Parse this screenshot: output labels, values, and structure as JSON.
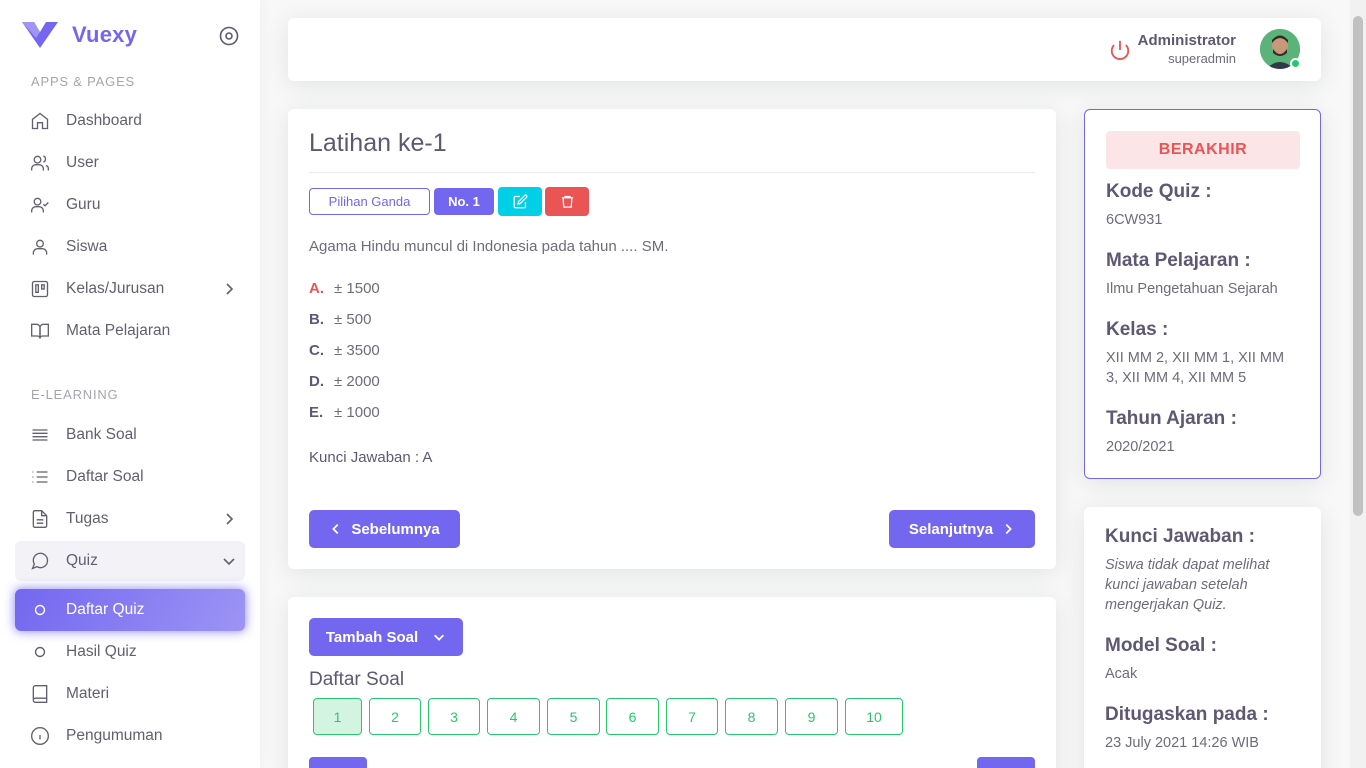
{
  "brand": {
    "name": "Vuexy"
  },
  "sidebar": {
    "section_apps": "APPS & PAGES",
    "section_elearning": "E-LEARNING",
    "items": [
      {
        "label": "Dashboard"
      },
      {
        "label": "User"
      },
      {
        "label": "Guru"
      },
      {
        "label": "Siswa"
      },
      {
        "label": "Kelas/Jurusan"
      },
      {
        "label": "Mata Pelajaran"
      },
      {
        "label": "Bank Soal"
      },
      {
        "label": "Daftar Soal"
      },
      {
        "label": "Tugas"
      },
      {
        "label": "Quiz"
      },
      {
        "label": "Daftar Quiz"
      },
      {
        "label": "Hasil Quiz"
      },
      {
        "label": "Materi"
      },
      {
        "label": "Pengumuman"
      }
    ]
  },
  "navbar": {
    "user_name": "Administrator",
    "user_role": "superadmin"
  },
  "question": {
    "title": "Latihan ke-1",
    "type_badge": "Pilihan Ganda",
    "number_badge": "No. 1",
    "text": "Agama Hindu muncul di Indonesia pada tahun .... SM.",
    "options": [
      {
        "letter": "A.",
        "text": "± 1500"
      },
      {
        "letter": "B.",
        "text": "± 500"
      },
      {
        "letter": "C.",
        "text": "± 3500"
      },
      {
        "letter": "D.",
        "text": "± 2000"
      },
      {
        "letter": "E.",
        "text": "± 1000"
      }
    ],
    "answer_key": "Kunci Jawaban : A",
    "prev_label": "Sebelumnya",
    "next_label": "Selanjutnya"
  },
  "question_list": {
    "add_label": "Tambah Soal",
    "title": "Daftar Soal",
    "numbers": [
      "1",
      "2",
      "3",
      "4",
      "5",
      "6",
      "7",
      "8",
      "9",
      "10"
    ]
  },
  "info": {
    "status": "BERAKHIR",
    "code_label": "Kode Quiz :",
    "code_value": "6CW931",
    "subject_label": "Mata Pelajaran :",
    "subject_value": "Ilmu Pengetahuan Sejarah",
    "class_label": "Kelas :",
    "class_value": "XII MM 2, XII MM 1, XII MM 3, XII MM 4, XII MM 5",
    "year_label": "Tahun Ajaran :",
    "year_value": "2020/2021"
  },
  "info2": {
    "key_label": "Kunci Jawaban :",
    "key_value": "Siswa tidak dapat melihat kunci jawaban setelah mengerjakan Quiz.",
    "model_label": "Model Soal :",
    "model_value": "Acak",
    "assigned_label": "Ditugaskan pada :",
    "assigned_value": "23 July 2021 14:26 WIB"
  },
  "colors": {
    "primary": "#7367f0",
    "danger": "#ea5455",
    "info": "#00cfe8",
    "success": "#28c76f"
  }
}
